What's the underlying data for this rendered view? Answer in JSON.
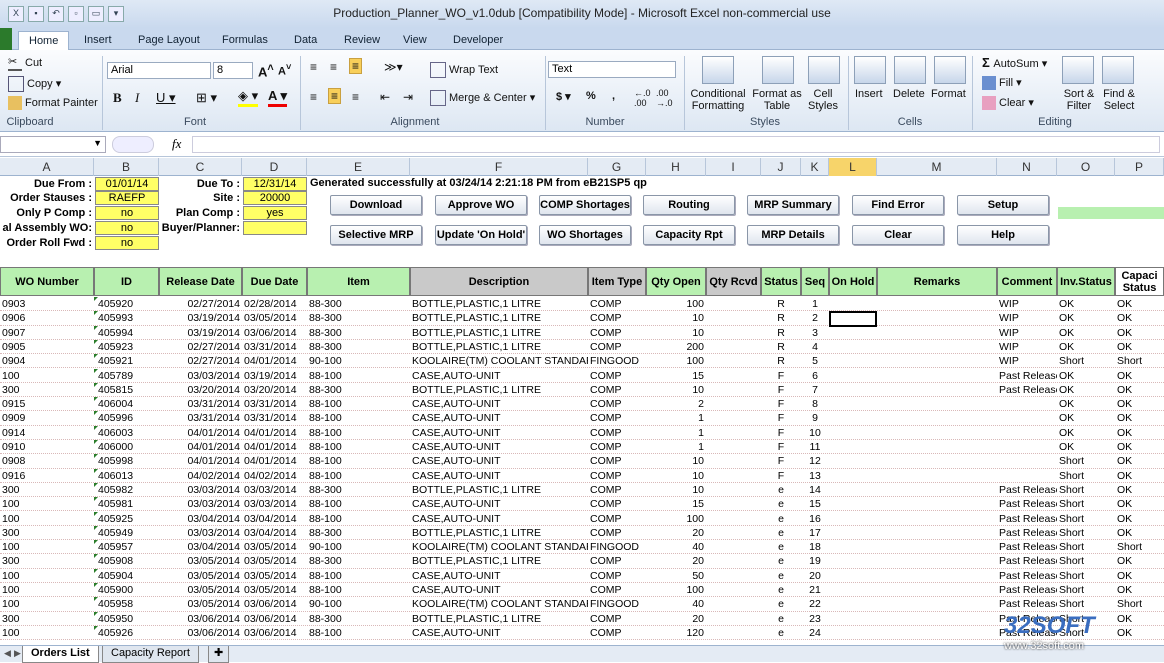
{
  "window": {
    "title": "Production_Planner_WO_v1.0dub  [Compatibility Mode]  -  Microsoft Excel non-commercial use"
  },
  "tabs": [
    "Home",
    "Insert",
    "Page Layout",
    "Formulas",
    "Data",
    "Review",
    "View",
    "Developer"
  ],
  "clipboard": {
    "cut": "Cut",
    "copy": "Copy",
    "format_painter": "Format Painter",
    "label": "Clipboard"
  },
  "font": {
    "name": "Arial",
    "size": "8",
    "label": "Font"
  },
  "alignment": {
    "wrap_text": "Wrap Text",
    "merge_center": "Merge & Center",
    "label": "Alignment"
  },
  "number": {
    "format": "Text",
    "label": "Number",
    "currency": "$",
    "percent": "%",
    "comma": ","
  },
  "styles": {
    "conditional": "Conditional Formatting",
    "format_table": "Format as Table",
    "cell_styles": "Cell Styles",
    "label": "Styles"
  },
  "cells": {
    "insert": "Insert",
    "delete": "Delete",
    "format": "Format",
    "label": "Cells"
  },
  "editing": {
    "autosum": "AutoSum",
    "fill": "Fill",
    "clear": "Clear",
    "sort_filter": "Sort & Filter",
    "find_select": "Find & Select",
    "label": "Editing"
  },
  "formula_bar": {
    "fx": "fx",
    "value": ""
  },
  "columns": [
    "A",
    "B",
    "C",
    "D",
    "E",
    "F",
    "G",
    "H",
    "I",
    "J",
    "K",
    "L",
    "M",
    "N",
    "O",
    "P"
  ],
  "params": {
    "due_from": "Due From :",
    "due_from_val": "01/01/14",
    "order_statuses": "Order Stauses :",
    "order_statuses_val": "RAEFP",
    "only_p_comp": "Only P Comp :",
    "only_p_comp_val": "no",
    "final_assembly": "al Assembly WO:",
    "final_assembly_val": "no",
    "order_roll_fwd": "Order Roll Fwd :",
    "order_roll_fwd_val": "no",
    "due_to": "Due To :",
    "due_to_val": "12/31/14",
    "site": "Site :",
    "site_val": "20000",
    "plan_comp": "Plan Comp :",
    "plan_comp_val": "yes",
    "buyer": "Buyer/Planner:",
    "buyer_val": "",
    "generated": "Generated successfully at 03/24/14 2:21:18 PM from eB21SP5 qp"
  },
  "buttons": [
    "Download",
    "Approve WO",
    "COMP Shortages",
    "Routing",
    "MRP Summary",
    "Find Error",
    "Setup",
    "Selective MRP",
    "Update 'On Hold'",
    "WO Shortages",
    "Capacity Rpt",
    "MRP Details",
    "Clear",
    "Help"
  ],
  "table_headers": [
    "WO Number",
    "ID",
    "Release Date",
    "Due Date",
    "Item",
    "Description",
    "Item Type",
    "Qty Open",
    "Qty Rcvd",
    "Status",
    "Seq",
    "On Hold",
    "Remarks",
    "Comment",
    "Inv.Status",
    "Capaci Status"
  ],
  "rows": [
    [
      "0903",
      "405920",
      "02/27/2014",
      "02/28/2014",
      "88-300",
      "BOTTLE,PLASTIC,1 LITRE",
      "COMP",
      "100",
      "",
      "R",
      "1",
      "",
      "",
      "WIP",
      "OK",
      "OK"
    ],
    [
      "0906",
      "405993",
      "03/19/2014",
      "03/05/2014",
      "88-300",
      "BOTTLE,PLASTIC,1 LITRE",
      "COMP",
      "10",
      "",
      "R",
      "2",
      "",
      "",
      "WIP",
      "OK",
      "OK"
    ],
    [
      "0907",
      "405994",
      "03/19/2014",
      "03/06/2014",
      "88-300",
      "BOTTLE,PLASTIC,1 LITRE",
      "COMP",
      "10",
      "",
      "R",
      "3",
      "",
      "",
      "WIP",
      "OK",
      "OK"
    ],
    [
      "0905",
      "405923",
      "02/27/2014",
      "03/31/2014",
      "88-300",
      "BOTTLE,PLASTIC,1 LITRE",
      "COMP",
      "200",
      "",
      "R",
      "4",
      "",
      "",
      "WIP",
      "OK",
      "OK"
    ],
    [
      "0904",
      "405921",
      "02/27/2014",
      "04/01/2014",
      "90-100",
      "KOOLAIRE(TM) COOLANT STANDARD",
      "FINGOOD",
      "100",
      "",
      "R",
      "5",
      "",
      "",
      "WIP",
      "Short",
      "Short"
    ],
    [
      "100",
      "405789",
      "03/03/2014",
      "03/19/2014",
      "88-100",
      "CASE,AUTO-UNIT",
      "COMP",
      "15",
      "",
      "F",
      "6",
      "",
      "",
      "Past Release",
      "OK",
      "OK"
    ],
    [
      "300",
      "405815",
      "03/20/2014",
      "03/20/2014",
      "88-300",
      "BOTTLE,PLASTIC,1 LITRE",
      "COMP",
      "10",
      "",
      "F",
      "7",
      "",
      "",
      "Past Release",
      "OK",
      "OK"
    ],
    [
      "0915",
      "406004",
      "03/31/2014",
      "03/31/2014",
      "88-100",
      "CASE,AUTO-UNIT",
      "COMP",
      "2",
      "",
      "F",
      "8",
      "",
      "",
      "",
      "OK",
      "OK"
    ],
    [
      "0909",
      "405996",
      "03/31/2014",
      "03/31/2014",
      "88-100",
      "CASE,AUTO-UNIT",
      "COMP",
      "1",
      "",
      "F",
      "9",
      "",
      "",
      "",
      "OK",
      "OK"
    ],
    [
      "0914",
      "406003",
      "04/01/2014",
      "04/01/2014",
      "88-100",
      "CASE,AUTO-UNIT",
      "COMP",
      "1",
      "",
      "F",
      "10",
      "",
      "",
      "",
      "OK",
      "OK"
    ],
    [
      "0910",
      "406000",
      "04/01/2014",
      "04/01/2014",
      "88-100",
      "CASE,AUTO-UNIT",
      "COMP",
      "1",
      "",
      "F",
      "11",
      "",
      "",
      "",
      "OK",
      "OK"
    ],
    [
      "0908",
      "405998",
      "04/01/2014",
      "04/01/2014",
      "88-100",
      "CASE,AUTO-UNIT",
      "COMP",
      "10",
      "",
      "F",
      "12",
      "",
      "",
      "",
      "Short",
      "OK"
    ],
    [
      "0916",
      "406013",
      "04/02/2014",
      "04/02/2014",
      "88-100",
      "CASE,AUTO-UNIT",
      "COMP",
      "10",
      "",
      "F",
      "13",
      "",
      "",
      "",
      "Short",
      "OK"
    ],
    [
      "300",
      "405982",
      "03/03/2014",
      "03/03/2014",
      "88-300",
      "BOTTLE,PLASTIC,1 LITRE",
      "COMP",
      "10",
      "",
      "e",
      "14",
      "",
      "",
      "Past Release",
      "Short",
      "OK"
    ],
    [
      "100",
      "405981",
      "03/03/2014",
      "03/03/2014",
      "88-100",
      "CASE,AUTO-UNIT",
      "COMP",
      "15",
      "",
      "e",
      "15",
      "",
      "",
      "Past Release",
      "Short",
      "OK"
    ],
    [
      "100",
      "405925",
      "03/04/2014",
      "03/04/2014",
      "88-100",
      "CASE,AUTO-UNIT",
      "COMP",
      "100",
      "",
      "e",
      "16",
      "",
      "",
      "Past Release",
      "Short",
      "OK"
    ],
    [
      "300",
      "405949",
      "03/03/2014",
      "03/04/2014",
      "88-300",
      "BOTTLE,PLASTIC,1 LITRE",
      "COMP",
      "20",
      "",
      "e",
      "17",
      "",
      "",
      "Past Release",
      "Short",
      "OK"
    ],
    [
      "100",
      "405957",
      "03/04/2014",
      "03/05/2014",
      "90-100",
      "KOOLAIRE(TM) COOLANT STANDARD",
      "FINGOOD",
      "40",
      "",
      "e",
      "18",
      "",
      "",
      "Past Release",
      "Short",
      "Short"
    ],
    [
      "300",
      "405908",
      "03/05/2014",
      "03/05/2014",
      "88-300",
      "BOTTLE,PLASTIC,1 LITRE",
      "COMP",
      "20",
      "",
      "e",
      "19",
      "",
      "",
      "Past Release",
      "Short",
      "OK"
    ],
    [
      "100",
      "405904",
      "03/05/2014",
      "03/05/2014",
      "88-100",
      "CASE,AUTO-UNIT",
      "COMP",
      "50",
      "",
      "e",
      "20",
      "",
      "",
      "Past Release",
      "Short",
      "OK"
    ],
    [
      "100",
      "405900",
      "03/05/2014",
      "03/05/2014",
      "88-100",
      "CASE,AUTO-UNIT",
      "COMP",
      "100",
      "",
      "e",
      "21",
      "",
      "",
      "Past Release",
      "Short",
      "OK"
    ],
    [
      "100",
      "405958",
      "03/05/2014",
      "03/06/2014",
      "90-100",
      "KOOLAIRE(TM) COOLANT STANDARD",
      "FINGOOD",
      "40",
      "",
      "e",
      "22",
      "",
      "",
      "Past Release",
      "Short",
      "Short"
    ],
    [
      "300",
      "405950",
      "03/06/2014",
      "03/06/2014",
      "88-300",
      "BOTTLE,PLASTIC,1 LITRE",
      "COMP",
      "20",
      "",
      "e",
      "23",
      "",
      "",
      "Past Release",
      "Short",
      "OK"
    ],
    [
      "100",
      "405926",
      "03/06/2014",
      "03/06/2014",
      "88-100",
      "CASE,AUTO-UNIT",
      "COMP",
      "120",
      "",
      "e",
      "24",
      "",
      "",
      "Past Release",
      "Short",
      "OK"
    ]
  ],
  "sheet_tabs": [
    "Orders List",
    "Capacity Report"
  ],
  "watermark": {
    "brand": "32SOFT",
    "url": "www.32soft.com"
  }
}
